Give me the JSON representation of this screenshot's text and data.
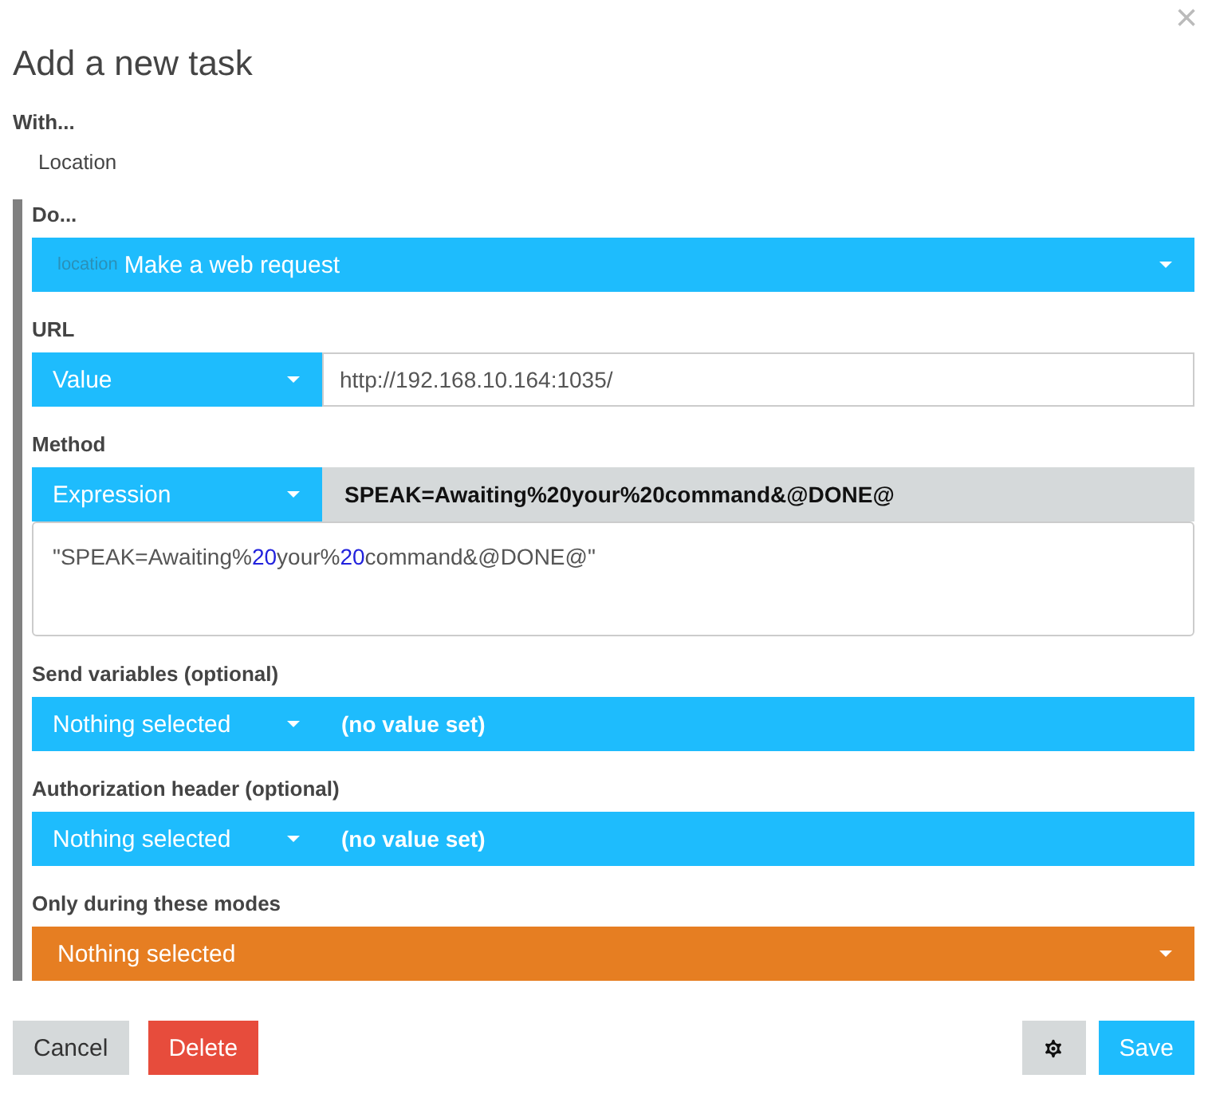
{
  "dialog": {
    "close": "×",
    "title": "Add a new task"
  },
  "with": {
    "label": "With...",
    "value": "Location"
  },
  "fields": [
    {
      "kind": "dropdown",
      "label": "Do...",
      "hint": "location",
      "value": "Make a web request",
      "color": "#1ebcfd"
    },
    {
      "kind": "input",
      "label": "URL",
      "mode": "Value",
      "value": "http://192.168.10.164:1035/"
    },
    {
      "kind": "expression",
      "label": "Method",
      "mode": "Expression",
      "preview": "SPEAK=Awaiting%20your%20command&@DONE@",
      "code": [
        {
          "text": "\"SPEAK=Awaiting%",
          "kind": "plain"
        },
        {
          "text": "20",
          "kind": "number"
        },
        {
          "text": "your%",
          "kind": "plain"
        },
        {
          "text": "20",
          "kind": "number"
        },
        {
          "text": "command&@DONE@\"",
          "kind": "plain"
        }
      ]
    },
    {
      "kind": "selector",
      "label": "Send variables (optional)",
      "mode": "Nothing selected",
      "value": "(no value set)"
    },
    {
      "kind": "selector",
      "label": "Authorization header (optional)",
      "mode": "Nothing selected",
      "value": "(no value set)"
    },
    {
      "kind": "dropdown",
      "label": "Only during these modes",
      "value": "Nothing selected",
      "color": "#e67e22"
    }
  ],
  "buttons": {
    "cancel": "Cancel",
    "delete": "Delete",
    "save": "Save"
  }
}
